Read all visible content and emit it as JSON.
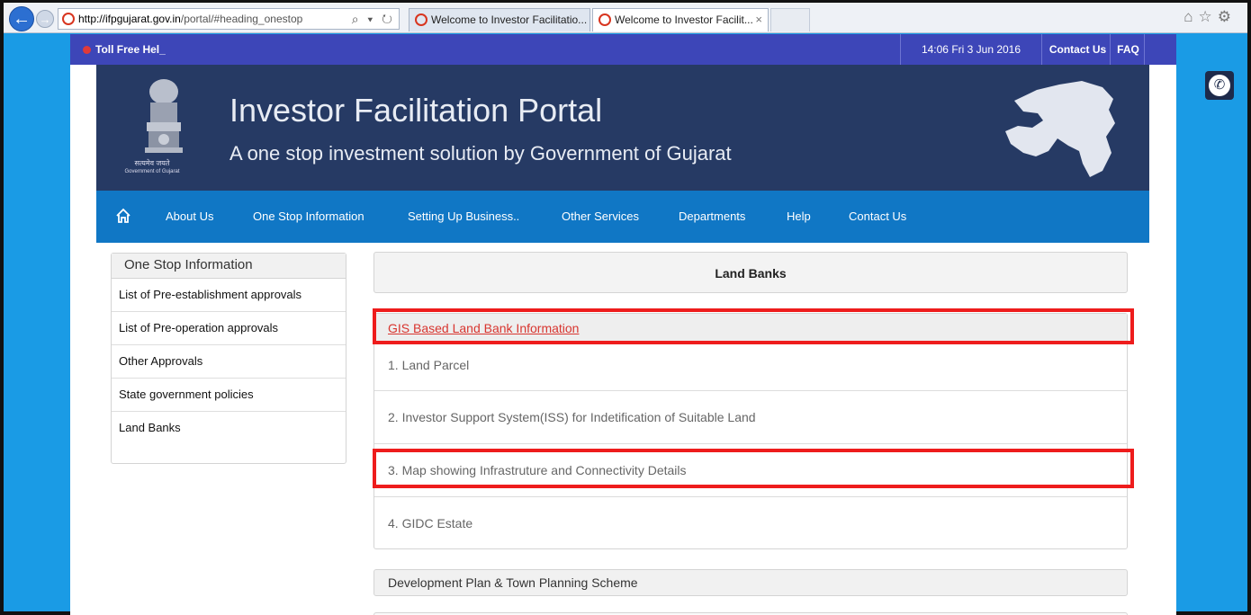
{
  "browser": {
    "url_host": "http://ifpgujarat.gov.in",
    "url_path": "/portal/#heading_onestop",
    "url_tools": "⌕ ▾ ↻",
    "tabs": [
      {
        "title": "Welcome to Investor Facilitatio...",
        "active": false
      },
      {
        "title": "Welcome to Investor Facilit...",
        "active": true
      }
    ],
    "tab_close": "×",
    "icons": [
      "home-icon",
      "star-icon",
      "gear-icon"
    ]
  },
  "topbar": {
    "toll_free": "Toll Free Hel_",
    "datetime": "14:06  Fri  3 Jun 2016",
    "links": [
      "Contact Us",
      "FAQ"
    ]
  },
  "header": {
    "title": "Investor Facilitation Portal",
    "subtitle": "A one stop investment solution by Government of Gujarat",
    "emblem_motto": "सत्यमेव जयते",
    "emblem_caption": "Government of Gujarat"
  },
  "menu": {
    "items": [
      "About Us",
      "One Stop Information",
      "Setting Up Business..",
      "Other Services",
      "Departments",
      "Help",
      "Contact Us"
    ]
  },
  "sidebar": {
    "title": "One Stop Information",
    "items": [
      "List of Pre-establishment approvals",
      "List of Pre-operation approvals",
      "Other Approvals",
      "State government policies",
      "Land Banks"
    ]
  },
  "main": {
    "heading": "Land Banks",
    "gis_link": "GIS Based Land Bank Information",
    "items": [
      "1. Land Parcel",
      "2. Investor Support System(ISS) for Indetification of Suitable Land",
      "3. Map showing Infrastruture and Connectivity Details",
      "4. GIDC Estate"
    ],
    "next_section": "Development Plan & Town Planning Scheme"
  },
  "colors": {
    "topbar": "#3d46b8",
    "header": "#263a64",
    "menubar": "#1077c5",
    "page_bg": "#1a9be5",
    "highlight": "#ee1c1c",
    "link": "#d8352f"
  }
}
